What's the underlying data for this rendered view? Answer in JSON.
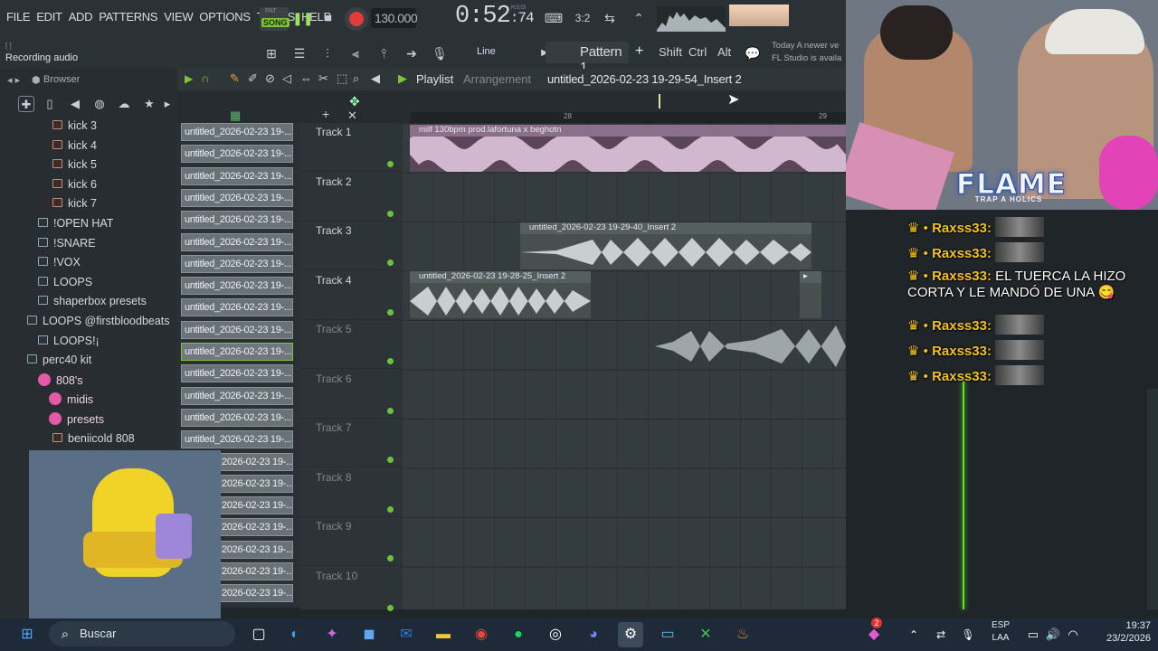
{
  "menu": [
    "FILE",
    "EDIT",
    "ADD",
    "PATTERNS",
    "VIEW",
    "OPTIONS",
    "TOOLS",
    "HELP"
  ],
  "transport": {
    "pat_label": "PAT",
    "song_label": "SONG",
    "tempo": "130.000",
    "time": "0:52",
    "time_ms": ":74",
    "time_caption": "M:S:CS",
    "play_icon": "pause-icon",
    "stop_icon": "stop-icon",
    "record_icon": "record-icon"
  },
  "hint": {
    "bracket": "[ ]",
    "status": "Recording audio"
  },
  "toolbar2": {
    "snap": "Line",
    "pattern": "Pattern 1",
    "plus": "+",
    "shift": "Shift",
    "ctrl": "Ctrl",
    "alt": "Alt"
  },
  "news": {
    "line1": "Today  A newer ve",
    "line2": "FL Studio is availa"
  },
  "browser": {
    "title": "Browser",
    "items": [
      {
        "label": "kick 3",
        "type": "file"
      },
      {
        "label": "kick 4",
        "type": "file"
      },
      {
        "label": "kick 5",
        "type": "file"
      },
      {
        "label": "kick 6",
        "type": "file"
      },
      {
        "label": "kick 7",
        "type": "file"
      },
      {
        "label": "!OPEN HAT",
        "type": "folder"
      },
      {
        "label": "!SNARE",
        "type": "folder"
      },
      {
        "label": "!VOX",
        "type": "folder"
      },
      {
        "label": "LOOPS",
        "type": "folder"
      },
      {
        "label": "shaperbox presets",
        "type": "folder"
      },
      {
        "label": "LOOPS @firstbloodbeats",
        "type": "folder"
      },
      {
        "label": "LOOPS!¡",
        "type": "folder"
      },
      {
        "label": "perc40 kit",
        "type": "folder"
      },
      {
        "label": "808's",
        "type": "pink"
      },
      {
        "label": "midis",
        "type": "pink"
      },
      {
        "label": "presets",
        "type": "pink"
      },
      {
        "label": "beniicold 808",
        "type": "file"
      }
    ]
  },
  "cliplist": {
    "label": "untitled_2026-02-23 19-...",
    "partial": "2026-02-23 19-...",
    "count": 22
  },
  "playlist": {
    "title": "Playlist",
    "subtitle": "Arrangement",
    "current_clip": "untitled_2026-02-23 19-29-54_Insert 2",
    "ruler": [
      "28",
      "29"
    ],
    "tracks": [
      "Track 1",
      "Track 2",
      "Track 3",
      "Track 4",
      "Track 5",
      "Track 6",
      "Track 7",
      "Track 8",
      "Track 9",
      "Track 10"
    ],
    "clips": [
      {
        "label": "milf 130bpm prod.lafortuna x beghotn"
      },
      {
        "label": "untitled_2026-02-23 19-29-40_Insert 2"
      },
      {
        "label": "untitled_2026-02-23 19-28-25_Insert 2"
      }
    ]
  },
  "stream": {
    "banner": "FLAME",
    "banner_sub": "TRAP A HOLICS",
    "chat": [
      {
        "user": "Raxss33:",
        "text": ""
      },
      {
        "user": "Raxss33:",
        "text": ""
      },
      {
        "user": "Raxss33:",
        "text": "EL TUERCA LA HIZO",
        "text2": "CORTA Y LE MANDÓ DE UNA 😋"
      },
      {
        "user": "Raxss33:",
        "text": ""
      },
      {
        "user": "Raxss33:",
        "text": ""
      },
      {
        "user": "Raxss33:",
        "text": ""
      }
    ]
  },
  "taskbar": {
    "search": "Buscar",
    "lang1": "ESP",
    "lang2": "LAA",
    "time": "19:37",
    "date": "23/2/2026",
    "notif": "2"
  },
  "colors": {
    "accent": "#7ec531",
    "record": "#e23b3b",
    "playhead": "#65e022",
    "chat_user": "#f5c21b"
  }
}
